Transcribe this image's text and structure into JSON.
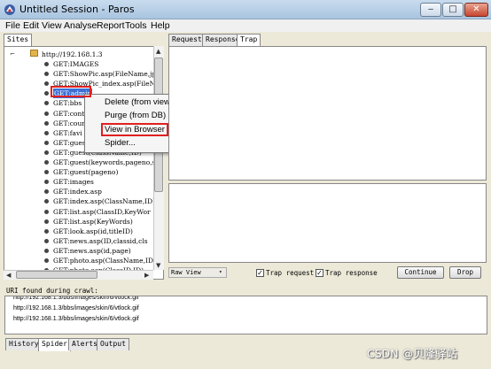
{
  "window": {
    "title": "Untitled Session - Paros"
  },
  "menu": [
    "File",
    "Edit",
    "View",
    "Analyse",
    "Report",
    "Tools",
    "Help"
  ],
  "left_tabs": [
    "Sites"
  ],
  "tree": {
    "root": "http://192.168.1.3",
    "items": [
      "GET:IMAGES",
      "GET:ShowPic.asp(FileName,jp",
      "GET:ShowPic_index.asp(FileN",
      "GET:admin",
      "GET:bbs",
      "GET:cont",
      "GET:coun",
      "GET:favi",
      "GET:gues",
      "GET:guest(ClassName,ID)",
      "GET:guest(keywords,pageno,s",
      "GET:guest(pageno)",
      "GET:images",
      "GET:index.asp",
      "GET:index.asp(ClassName,ID)",
      "GET:list.asp(ClassID,KeyWor",
      "GET:list.asp(KeyWords)",
      "GET:look.asp(id,titleID)",
      "GET:news.asp(ID,classid,cls",
      "GET:news.asp(id,page)",
      "GET:photo.asp(ClassName,ID)",
      "GET:photo.asp(ClassID,ID)"
    ]
  },
  "context_menu": [
    "Delete (from view)",
    "Purge (from DB)",
    "View in Browser",
    "Spider..."
  ],
  "right_tabs": [
    "Request",
    "Response",
    "Trap"
  ],
  "trap_bar": {
    "view_select": "Raw View",
    "trap_request_label": "Trap request",
    "trap_response_label": "Trap response",
    "trap_request_checked": true,
    "trap_response_checked": true,
    "continue_label": "Continue",
    "drop_label": "Drop"
  },
  "crawl": {
    "label": "URI found during crawl:",
    "lines": [
      "http://192.168.1.3/bbs/images/skin/6/vtlock.gif",
      "http://192.168.1.3/bbs/images/skin/6/vtlock.gif",
      "http://192.168.1.3/bbs/images/skin/6/vtlock.gif"
    ]
  },
  "bottom_tabs": [
    "History",
    "Spider",
    "Alerts",
    "Output"
  ],
  "watermark": "CSDN @贝隆驿站",
  "colors": {
    "highlight": "#3b6fd6",
    "annotation": "#e02020",
    "selected_text": "#ffffff"
  },
  "icons": {
    "app": "paros-logo-icon",
    "folder": "folder-icon",
    "node": "bullet-icon"
  }
}
